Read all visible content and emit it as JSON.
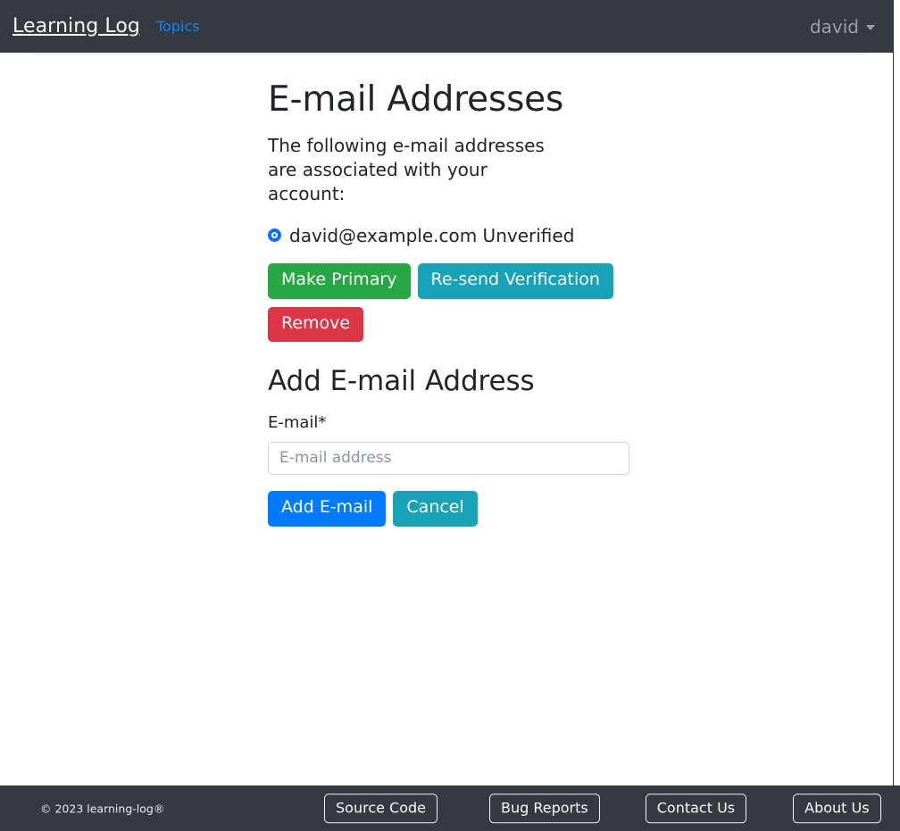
{
  "navbar": {
    "brand": "Learning Log",
    "links": [
      {
        "label": "Topics",
        "name": "nav-link-topics"
      }
    ],
    "user": {
      "label": "david",
      "caret_icon": "chevron-down-icon"
    },
    "background_color": "#343a40",
    "link_color": "#0d84fd"
  },
  "main": {
    "title": "E-mail Addresses",
    "intro": "The following e-mail addresses are associated with your account:",
    "email_entry": {
      "radio_icon": "radio-checked-icon",
      "address": "david@example.com",
      "status": "Unverified",
      "label": "david@example.com Unverified",
      "selected": true
    },
    "actions": {
      "make_primary": "Make Primary",
      "resend_verification": "Re-send Verification",
      "remove": "Remove"
    },
    "add_section": {
      "title": "Add E-mail Address",
      "field_label": "E-mail*",
      "input_value": "",
      "input_placeholder": "E-mail address",
      "submit": "Add E-mail",
      "cancel": "Cancel"
    }
  },
  "footer": {
    "copyright": "© 2023 learning-log®",
    "buttons": [
      {
        "label": "Source Code",
        "name": "footer-button-source-code"
      },
      {
        "label": "Bug Reports",
        "name": "footer-button-bug-reports"
      },
      {
        "label": "Contact Us",
        "name": "footer-button-contact-us"
      },
      {
        "label": "About Us",
        "name": "footer-button-about-us"
      }
    ],
    "background_color": "#343a40"
  },
  "colors": {
    "success": "#28a745",
    "info": "#17a2b8",
    "danger": "#dc3545",
    "primary": "#007bff",
    "dark": "#343a40"
  }
}
